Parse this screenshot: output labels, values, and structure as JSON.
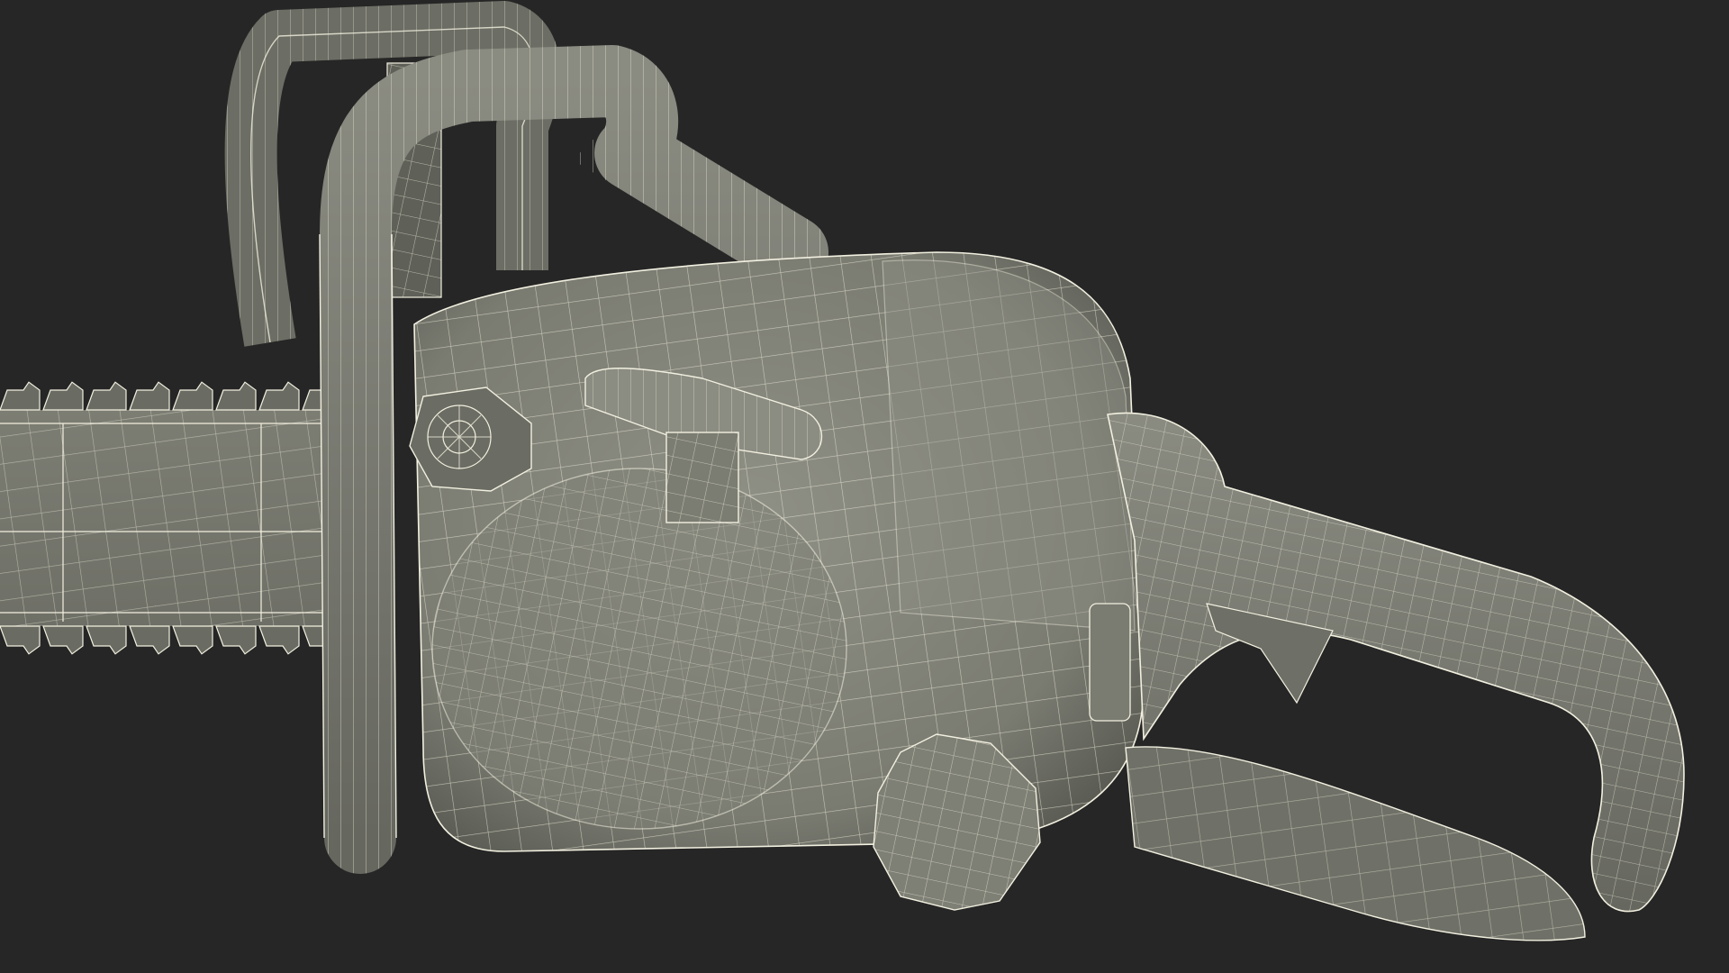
{
  "scene": {
    "subject": "chainsaw-wireframe-render",
    "colors": {
      "background": "#262626",
      "surface": "#7d7e74",
      "surface_light": "#8e8f85",
      "surface_dark": "#55564f",
      "wire": "#f2f0e0",
      "shadow": "#3e3f3a"
    }
  }
}
